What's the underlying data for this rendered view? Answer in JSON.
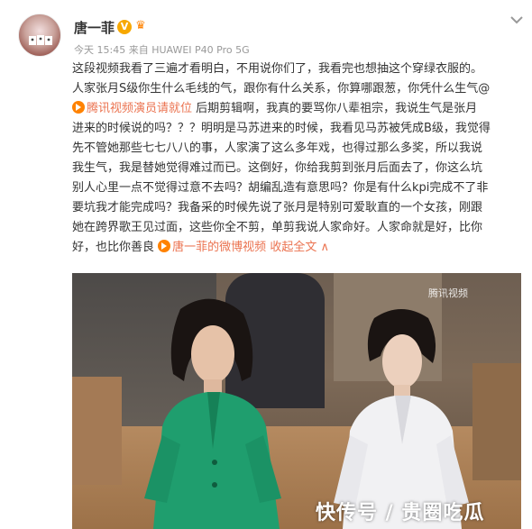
{
  "user": {
    "name": "唐一菲",
    "verified_badge": "V",
    "timestamp": "今天 15:45",
    "source": "来自 HUAWEI P40 Pro 5G"
  },
  "post": {
    "lines": [
      "这段视频我看了三遍才看明白，不用说你们了，我看完也想抽这个穿绿衣服的。",
      "人家张月S级你生什么毛线的气，跟你有什么关系，你算哪跟葱，你凭什么生气@",
      "后期剪辑啊，我真的要骂你八辈祖宗，我说生气是张月",
      "进来的时候说的吗？？？明明是马苏进来的时候，我看见马苏被凭成B级，我觉得",
      "先不管她那些七七八八的事，人家演了这么多年戏，也得过那么多奖，所以我说",
      "我生气，我是替她觉得难过而已。这倒好，你给我剪到张月后面去了，你这么坑",
      "别人心里一点不觉得过意不去吗？胡编乱造有意思吗？你是有什么kpi完成不了非",
      "要坑我才能完成吗？我备采的时候先说了张月是特别可爱耿直的一个女孩，刚跟",
      "她在跨界歌王见过面，这些你全不剪，单剪我说人家命好。人家命就是好，比你",
      "好，也比你善良"
    ],
    "mention_link": "腾讯视频演员请就位",
    "video_link": "唐一菲的微博视频",
    "collapse_label": "收起全文",
    "collapse_arrow": "∧"
  },
  "video": {
    "logo_text": "腾讯视频",
    "watermark": "快传号 / 贵圈吃瓜"
  },
  "icons": {
    "more": "chevron-down-icon",
    "member": "crown-icon",
    "link": "play-link-icon"
  },
  "colors": {
    "link": "#eb7350",
    "verified": "#f7a800"
  }
}
